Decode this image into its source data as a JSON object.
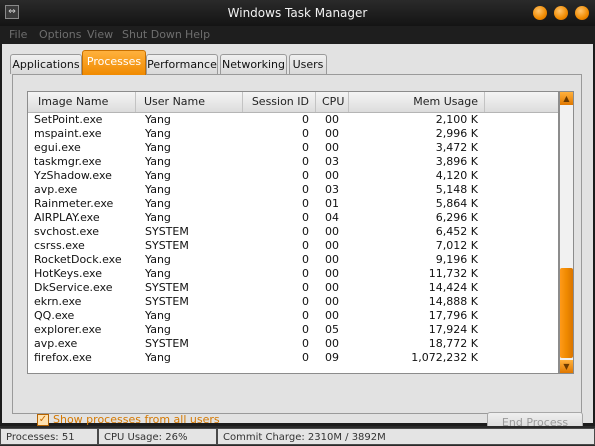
{
  "window": {
    "title": "Windows Task Manager",
    "icon": "task-manager-icon"
  },
  "menu": [
    "File",
    "Options",
    "View",
    "Shut Down",
    "Help"
  ],
  "tabs": [
    {
      "label": "Applications",
      "active": false
    },
    {
      "label": "Processes",
      "active": true
    },
    {
      "label": "Performance",
      "active": false
    },
    {
      "label": "Networking",
      "active": false
    },
    {
      "label": "Users",
      "active": false
    }
  ],
  "columns": [
    "Image Name",
    "User Name",
    "Session ID",
    "CPU",
    "Mem Usage"
  ],
  "processes": [
    {
      "name": "SetPoint.exe",
      "user": "Yang",
      "session": "0",
      "cpu": "00",
      "mem": "2,100 K"
    },
    {
      "name": "mspaint.exe",
      "user": "Yang",
      "session": "0",
      "cpu": "00",
      "mem": "2,996 K"
    },
    {
      "name": "egui.exe",
      "user": "Yang",
      "session": "0",
      "cpu": "00",
      "mem": "3,472 K"
    },
    {
      "name": "taskmgr.exe",
      "user": "Yang",
      "session": "0",
      "cpu": "03",
      "mem": "3,896 K"
    },
    {
      "name": "YzShadow.exe",
      "user": "Yang",
      "session": "0",
      "cpu": "00",
      "mem": "4,120 K"
    },
    {
      "name": "avp.exe",
      "user": "Yang",
      "session": "0",
      "cpu": "03",
      "mem": "5,148 K"
    },
    {
      "name": "Rainmeter.exe",
      "user": "Yang",
      "session": "0",
      "cpu": "01",
      "mem": "5,864 K"
    },
    {
      "name": "AIRPLAY.exe",
      "user": "Yang",
      "session": "0",
      "cpu": "04",
      "mem": "6,296 K"
    },
    {
      "name": "svchost.exe",
      "user": "SYSTEM",
      "session": "0",
      "cpu": "00",
      "mem": "6,452 K"
    },
    {
      "name": "csrss.exe",
      "user": "SYSTEM",
      "session": "0",
      "cpu": "00",
      "mem": "7,012 K"
    },
    {
      "name": "RocketDock.exe",
      "user": "Yang",
      "session": "0",
      "cpu": "00",
      "mem": "9,196 K"
    },
    {
      "name": "HotKeys.exe",
      "user": "Yang",
      "session": "0",
      "cpu": "00",
      "mem": "11,732 K"
    },
    {
      "name": "DkService.exe",
      "user": "SYSTEM",
      "session": "0",
      "cpu": "00",
      "mem": "14,424 K"
    },
    {
      "name": "ekrn.exe",
      "user": "SYSTEM",
      "session": "0",
      "cpu": "00",
      "mem": "14,888 K"
    },
    {
      "name": "QQ.exe",
      "user": "Yang",
      "session": "0",
      "cpu": "00",
      "mem": "17,796 K"
    },
    {
      "name": "explorer.exe",
      "user": "Yang",
      "session": "0",
      "cpu": "05",
      "mem": "17,924 K"
    },
    {
      "name": "avp.exe",
      "user": "SYSTEM",
      "session": "0",
      "cpu": "00",
      "mem": "18,772 K"
    },
    {
      "name": "firefox.exe",
      "user": "Yang",
      "session": "0",
      "cpu": "09",
      "mem": "1,072,232 K"
    }
  ],
  "show_all_users": {
    "label": "Show processes from all users",
    "checked": true
  },
  "end_process_label": "End Process",
  "status": {
    "processes": "Processes: 51",
    "cpu_usage": "CPU Usage: 26%",
    "commit_charge": "Commit Charge: 2310M / 3892M"
  },
  "colors": {
    "accent": "#f08a00",
    "accent_text": "#d47800"
  }
}
